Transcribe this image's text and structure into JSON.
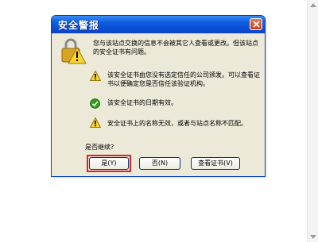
{
  "dialog": {
    "title": "安全警报",
    "close_label": "×",
    "intro": "您与该站点交换的信息不会被其它人查看或更改。但该站点的安全证书有问题。",
    "items": [
      {
        "icon": "warning-icon",
        "text": "该安全证书由您没有选定信任的公司颁发。可以查看证书以便确定您是否信任该验证机构。"
      },
      {
        "icon": "check-icon",
        "text": "该安全证书的日期有效。"
      },
      {
        "icon": "warning-icon",
        "text": "安全证书上的名称无效，或者与站点名称不匹配。"
      }
    ],
    "question": "是否继续?",
    "buttons": {
      "yes": "是(Y)",
      "no": "否(N)",
      "view_certificate": "查看证书(V)"
    }
  },
  "colors": {
    "title_bar": "#0a4fd6",
    "dialog_background": "#ece9d8",
    "focus_highlight": "#e0202a",
    "warning_yellow": "#f8d230",
    "check_green": "#2e9a1e"
  }
}
